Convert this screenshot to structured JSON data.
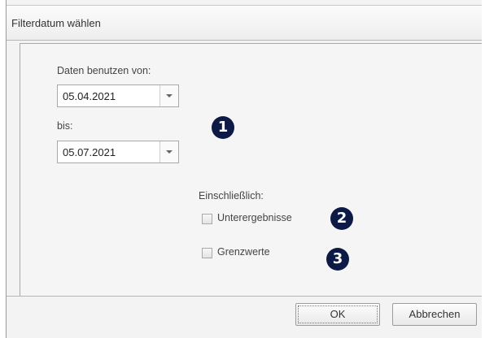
{
  "window": {
    "title": "Filterdatum wählen"
  },
  "form": {
    "from_label": "Daten benutzen von:",
    "from_value": "05.04.2021",
    "to_label": "bis:",
    "to_value": "05.07.2021",
    "include_label": "Einschließlich:",
    "checkbox_1_label": "Unterergebnisse",
    "checkbox_1_checked": false,
    "checkbox_2_label": "Grenzwerte",
    "checkbox_2_checked": false
  },
  "markers": {
    "m1": "1",
    "m2": "2",
    "m3": "3"
  },
  "buttons": {
    "ok": "OK",
    "cancel": "Abbrechen"
  },
  "colors": {
    "marker": "#0d1a45",
    "panel": "#f5f5f5"
  }
}
